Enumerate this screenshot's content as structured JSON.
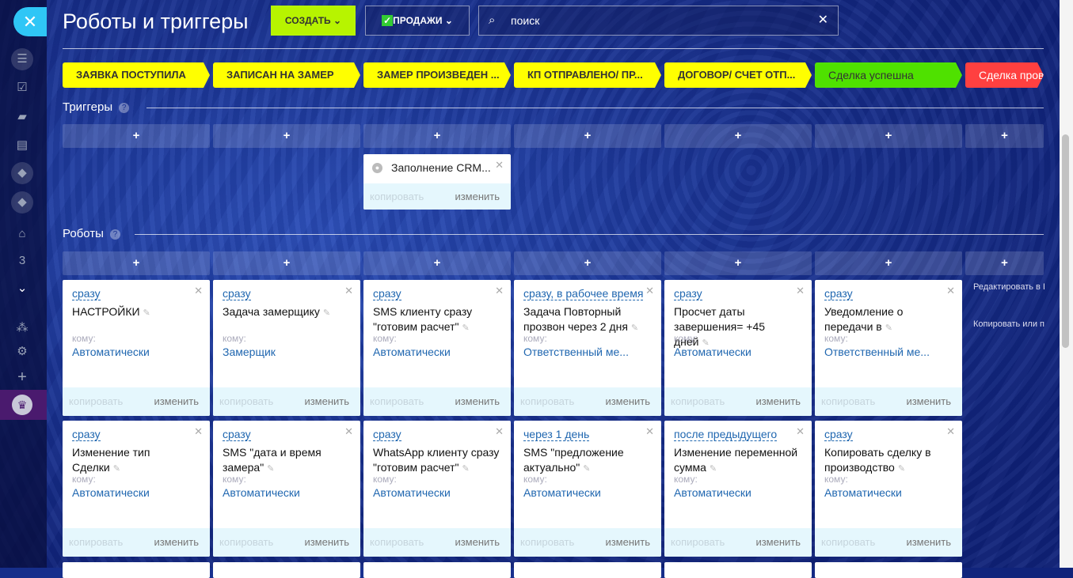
{
  "header": {
    "title": "Роботы и триггеры",
    "create_label": "СОЗДАТЬ",
    "sales_label": "ПРОДАЖИ",
    "search_value": "поиск"
  },
  "sidebar": {
    "counter": "3"
  },
  "colors": {
    "accent": "#2fc6f6",
    "create": "#b7f400",
    "stage_yellow": "#ffff00",
    "stage_green": "#4fe100",
    "stage_red": "#ff4040"
  },
  "stages": [
    {
      "label": "ЗАЯВКА ПОСТУПИЛА",
      "color": "#ffff00"
    },
    {
      "label": "ЗАПИСАН НА ЗАМЕР",
      "color": "#ffff00"
    },
    {
      "label": "ЗАМЕР ПРОИЗВЕДЕН ...",
      "color": "#ffff00"
    },
    {
      "label": "КП ОТПРАВЛЕНО/ ПР...",
      "color": "#ffff00"
    },
    {
      "label": "ДОГОВОР/ СЧЕТ ОТП...",
      "color": "#ffff00"
    },
    {
      "label": "Сделка успешна",
      "color": "#4fe100"
    },
    {
      "label": "Сделка пров",
      "color": "#ff4040"
    }
  ],
  "triggers": {
    "title": "Триггеры",
    "cards": [
      {
        "column": 2,
        "name": "Заполнение CRM...",
        "copy": "копировать",
        "edit": "изменить"
      }
    ]
  },
  "robots": {
    "title": "Роботы",
    "to_label": "кому:",
    "copy": "копировать",
    "edit": "изменить",
    "rows": [
      [
        {
          "when": "сразу",
          "name": "НАСТРОЙКИ",
          "to": "Автоматически"
        },
        {
          "when": "сразу",
          "name": "Задача замерщику",
          "to": "Замерщик"
        },
        {
          "when": "сразу",
          "name": "SMS клиенту сразу \"готовим расчет\"",
          "to": "Автоматически"
        },
        {
          "when": "сразу, в рабочее время",
          "name": "Задача Повторный прозвон через 2 дня",
          "to": "Ответственный ме..."
        },
        {
          "when": "сразу",
          "name": "Просчет даты завершения= +45 дней",
          "to": "Автоматически"
        },
        {
          "when": "сразу",
          "name": "Уведомление о передачи в",
          "to": "Ответственный ме..."
        }
      ],
      [
        {
          "when": "сразу",
          "name": "Изменение тип Сделки",
          "to": "Автоматически"
        },
        {
          "when": "сразу",
          "name": "SMS \"дата и время замера\"",
          "to": "Автоматически"
        },
        {
          "when": "сразу",
          "name": "WhatsApp клиенту сразу \"готовим расчет\"",
          "to": "Автоматически"
        },
        {
          "when": "через 1 день",
          "name": "SMS \"предложение актуально\"",
          "to": "Автоматически"
        },
        {
          "when": "после предыдущего",
          "name": "Изменение переменной сумма",
          "to": "Автоматически"
        },
        {
          "when": "сразу",
          "name": "Копировать сделку в производство",
          "to": "Автоматически"
        }
      ]
    ]
  },
  "side_links": [
    "Редактировать в Бизнес-процессе",
    "Копировать или перенести роботов"
  ]
}
